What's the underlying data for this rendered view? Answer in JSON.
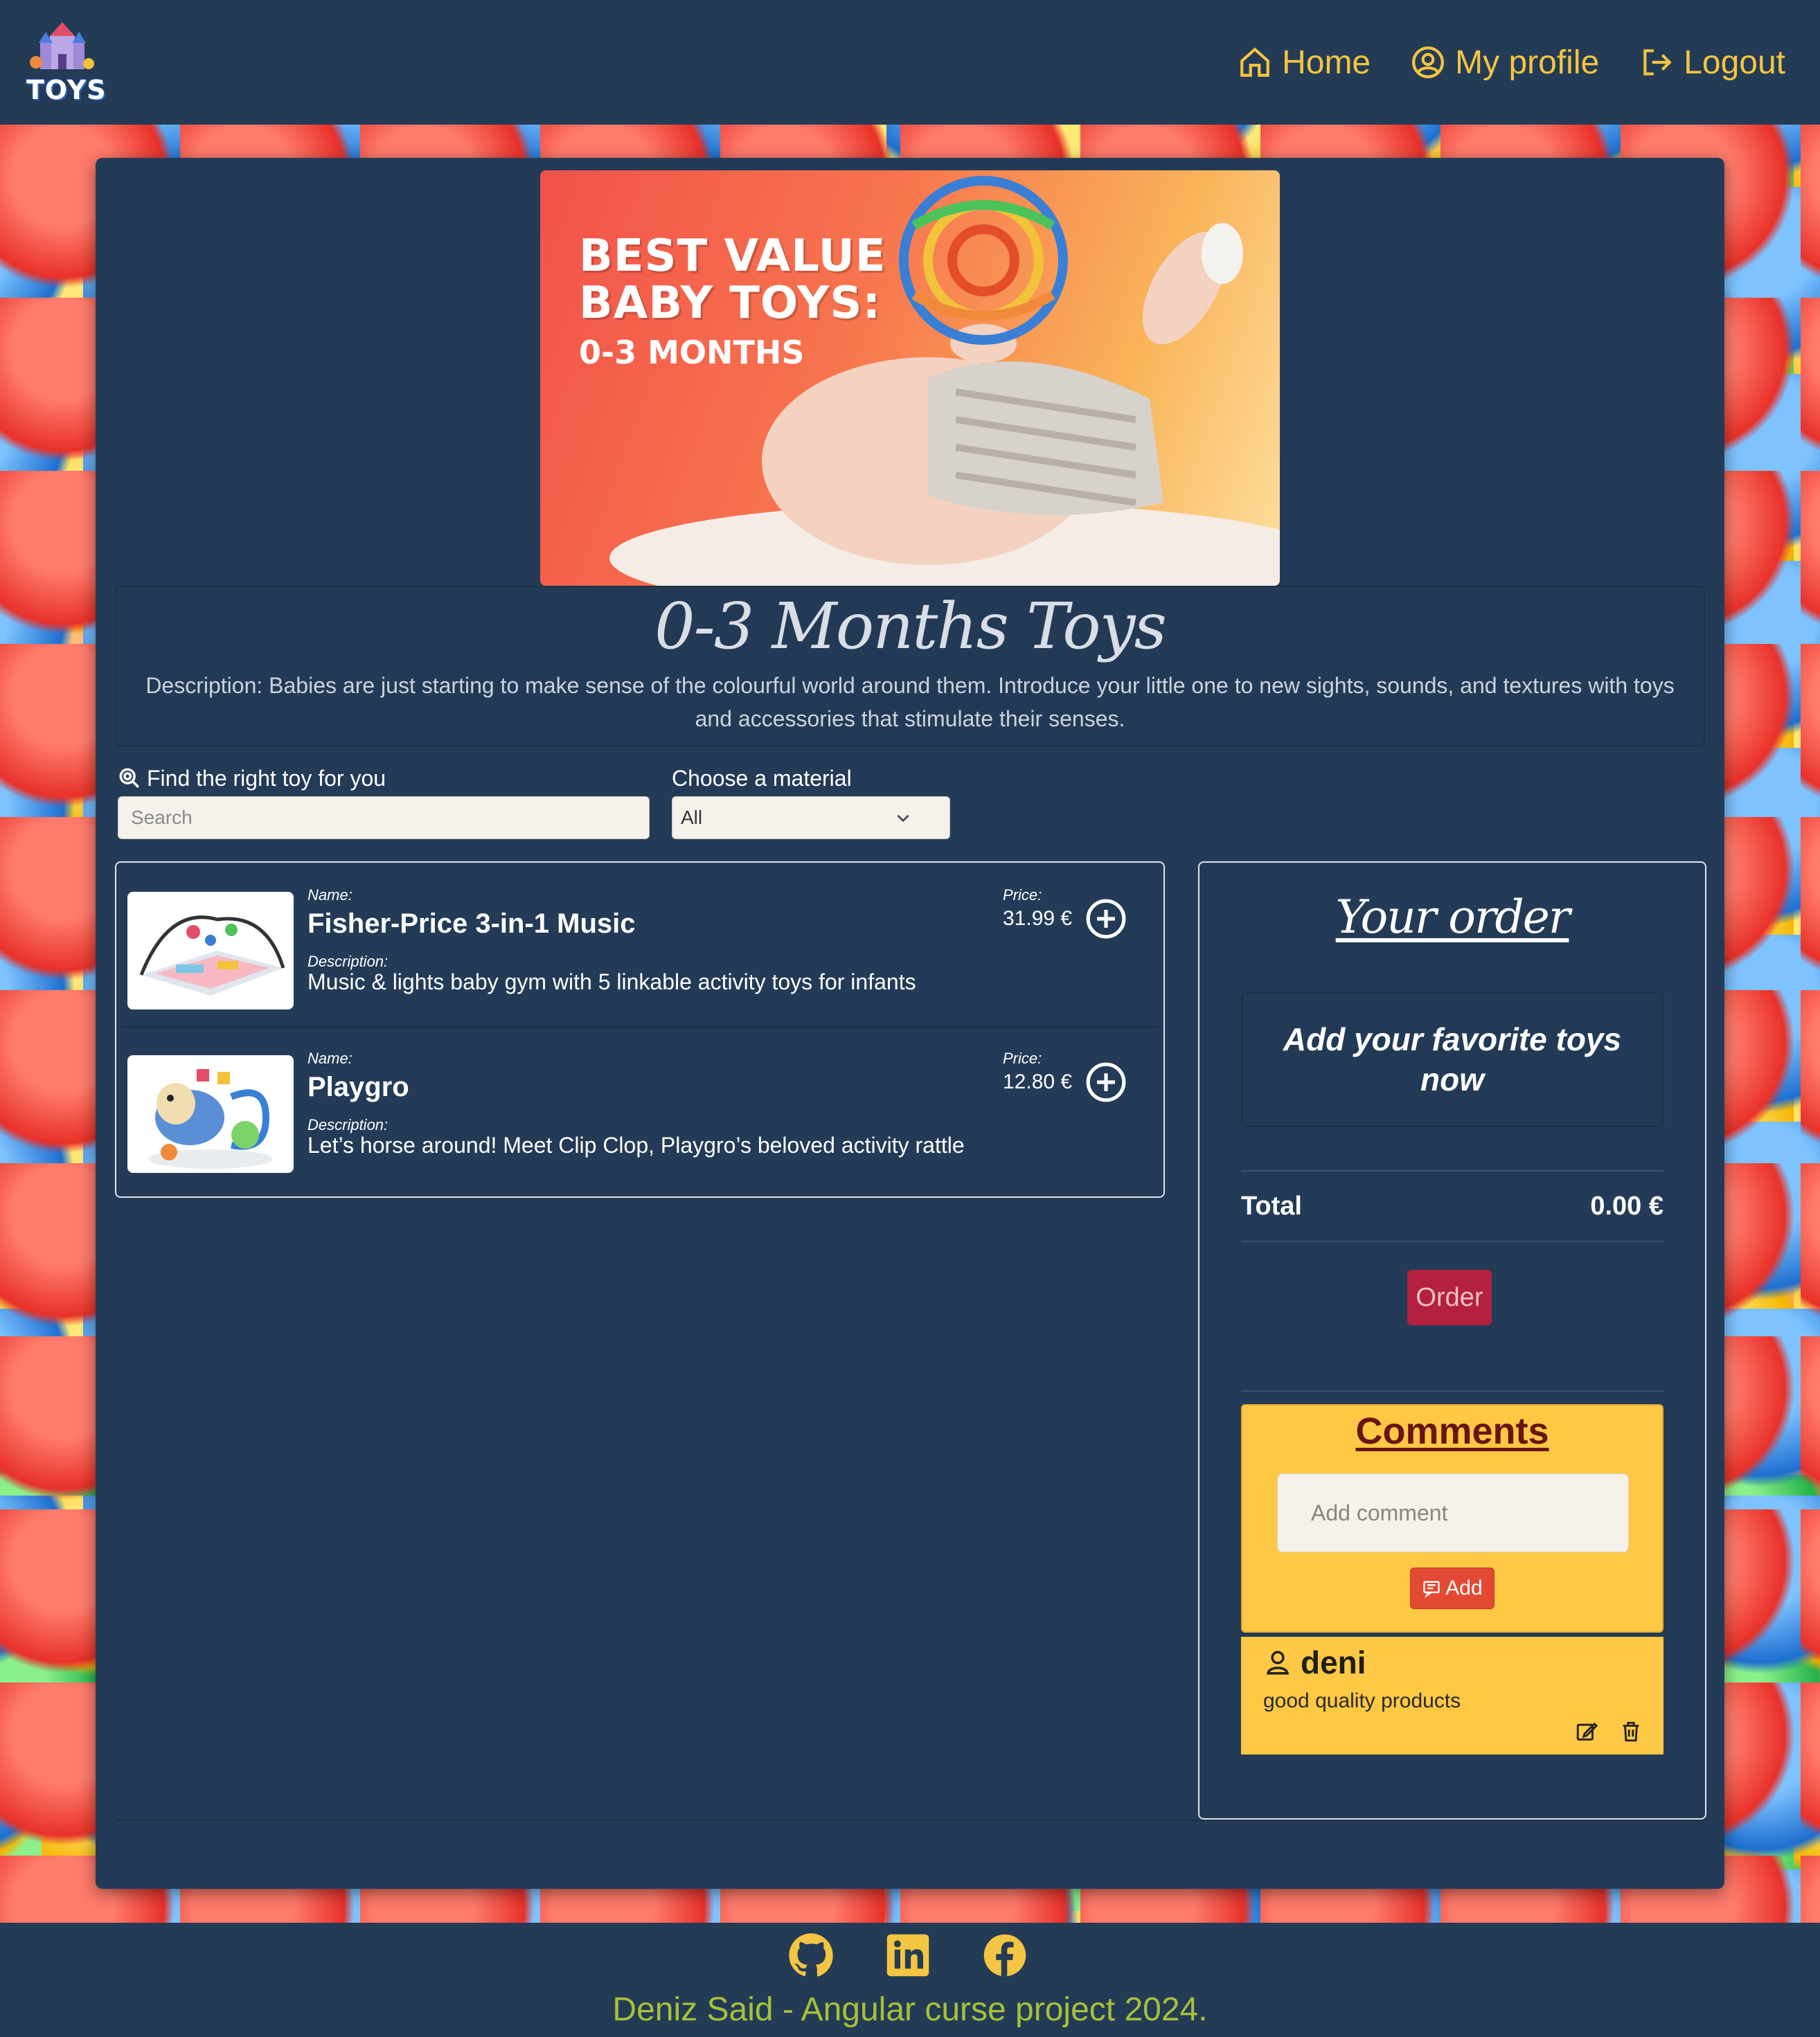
{
  "header": {
    "logo_text": "TOYS",
    "nav": [
      {
        "label": "Home",
        "icon": "home-icon"
      },
      {
        "label": "My profile",
        "icon": "user-circle-icon"
      },
      {
        "label": "Logout",
        "icon": "logout-icon"
      }
    ]
  },
  "banner": {
    "line1": "BEST VALUE",
    "line2": "BABY TOYS:",
    "line3": "0-3 MONTHS"
  },
  "category": {
    "title": "0-3 Months Toys",
    "description": "Description: Babies are just starting to make sense of the colourful world around them. Introduce your little one to new sights, sounds, and textures with toys and accessories that stimulate their senses."
  },
  "filters": {
    "search_label": "Find the right toy for you",
    "search_placeholder": "Search",
    "material_label": "Choose a material",
    "material_value": "All"
  },
  "products": [
    {
      "name_label": "Name:",
      "name": "Fisher-Price 3-in-1 Music",
      "description_label": "Description:",
      "description": "Music & lights baby gym with 5 linkable activity toys for infants",
      "price_label": "Price:",
      "price": "31.99 €"
    },
    {
      "name_label": "Name:",
      "name": "Playgro",
      "description_label": "Description:",
      "description": "Let’s horse around! Meet Clip Clop, Playgro’s beloved activity rattle",
      "price_label": "Price:",
      "price": "12.80 €"
    }
  ],
  "order": {
    "title": "Your order",
    "empty_message": "Add your favorite toys now",
    "total_label": "Total",
    "total_value": "0.00 €",
    "order_button": "Order"
  },
  "comments": {
    "title": "Comments",
    "input_placeholder": "Add comment",
    "add_button": "Add",
    "items": [
      {
        "user": "deni",
        "text": "good quality products"
      }
    ]
  },
  "footer": {
    "text": "Deniz Said - Angular curse project 2024.",
    "socials": [
      "github-icon",
      "linkedin-icon",
      "facebook-icon"
    ]
  },
  "colors": {
    "header_bg": "#243b55",
    "accent_yellow": "#f4c542",
    "order_button": "#b3213f",
    "comments_bg": "#fdc844",
    "footer_text": "#a7c13a"
  }
}
